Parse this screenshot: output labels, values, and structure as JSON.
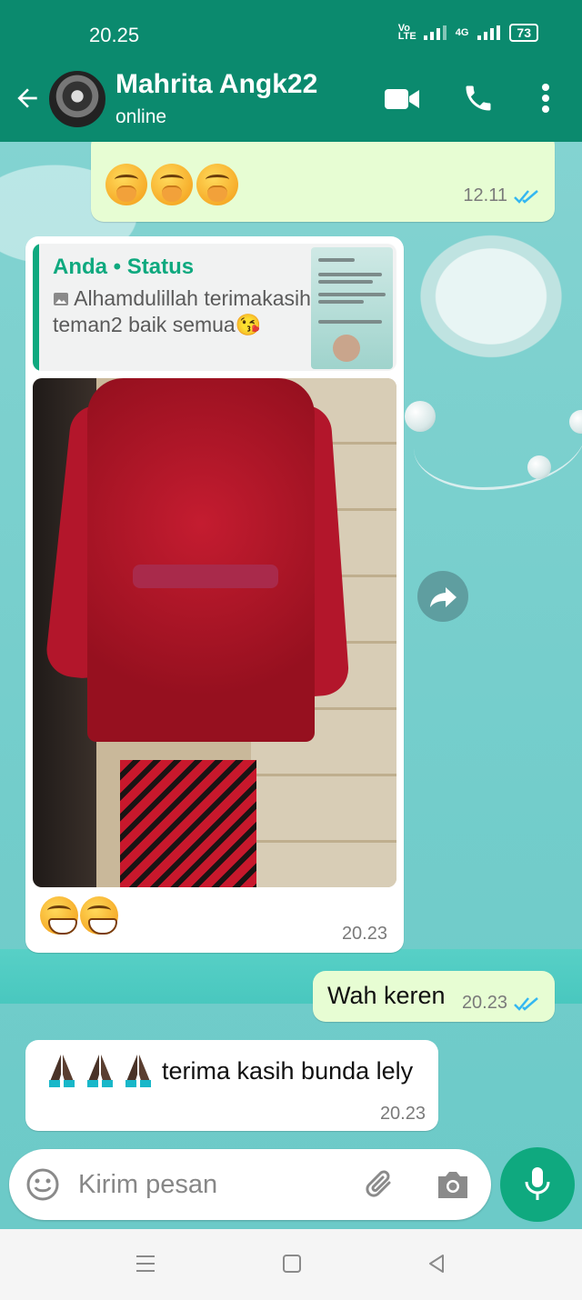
{
  "status_bar": {
    "time": "20.25",
    "network_label": "Vo LTE",
    "data_label": "4G",
    "battery": "73"
  },
  "header": {
    "contact_name": "Mahrita Angk22",
    "contact_status": "online",
    "icons": [
      "back-arrow-icon",
      "video-call-icon",
      "voice-call-icon",
      "more-options-icon"
    ]
  },
  "messages": [
    {
      "direction": "outgoing",
      "content": "emoji",
      "emoji": "hand-over-mouth x3",
      "time": "12.11",
      "read": true
    },
    {
      "direction": "incoming",
      "reply_to": {
        "title": "Anda • Status",
        "text": "Alhamdulillah terimakasih teman2 baik semua😘"
      },
      "image": "photo-red-lace-kebaya",
      "caption_emoji": "grinning x2",
      "time": "20.23"
    },
    {
      "direction": "outgoing",
      "text": "Wah keren",
      "time": "20.23",
      "read": true
    },
    {
      "direction": "incoming",
      "text": "terima kasih bunda lely",
      "emoji_prefix": "folded-hands x3",
      "time": "20.23"
    }
  ],
  "input": {
    "placeholder": "Kirim pesan"
  },
  "colors": {
    "header_green": "#0b8a6e",
    "accent_green": "#0fa97f",
    "outgoing_bubble": "#e7fdd3",
    "incoming_bubble": "#ffffff",
    "read_tick_blue": "#34b7f1",
    "wallpaper": "#74cfcd"
  }
}
